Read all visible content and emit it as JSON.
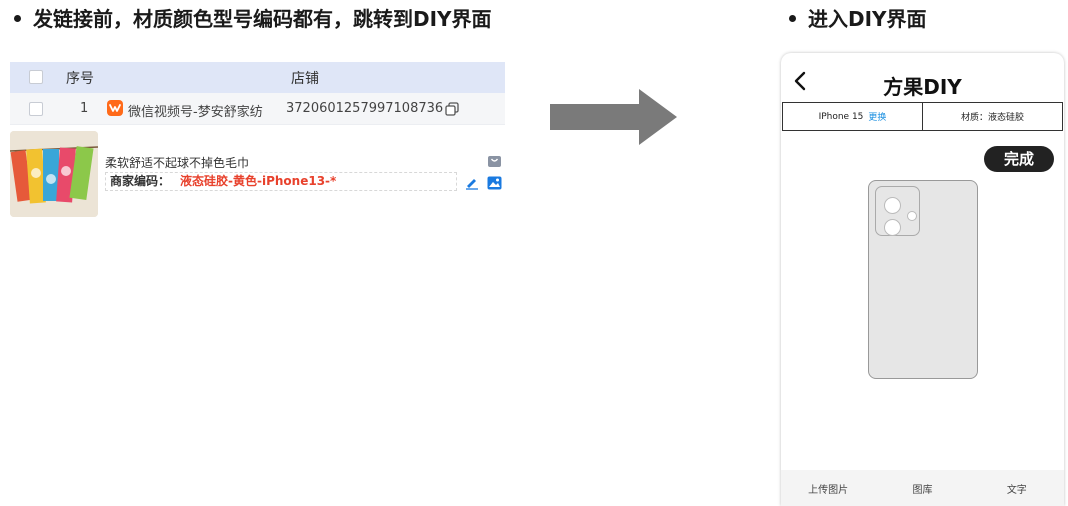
{
  "headings": {
    "left": "发链接前，材质颜色型号编码都有，跳转到DIY界面",
    "right": "进入DIY界面"
  },
  "table": {
    "columns": [
      "序号",
      "店铺"
    ],
    "rows": [
      {
        "no": "1",
        "shop": "微信视频号-梦安舒家纺",
        "shop_id": "3720601257997108736"
      }
    ]
  },
  "product": {
    "title": "柔软舒适不起球不掉色毛巾",
    "code_label": "商家编码：",
    "code_value": "液态硅胶-黄色-iPhone13-*"
  },
  "icons": {
    "shop_logo": "wechat-channels-icon",
    "copy": "copy-icon",
    "bag": "shopping-bag-icon",
    "edit": "edit-icon",
    "image": "image-icon",
    "arrow": "right-arrow-icon",
    "back": "back-chevron-icon"
  },
  "diy": {
    "title": "方果DIY",
    "model_label": "IPhone 15",
    "change_label": "更换",
    "material_label": "材质：液态硅胶",
    "done_label": "完成",
    "tools": [
      "上传图片",
      "图库",
      "文字"
    ]
  },
  "colors": {
    "header_bg": "#dfe6f7",
    "code_red": "#e8412c",
    "link_blue": "#1a8fe0",
    "arrow_gray": "#7a7a7a",
    "done_bg": "#222222"
  }
}
